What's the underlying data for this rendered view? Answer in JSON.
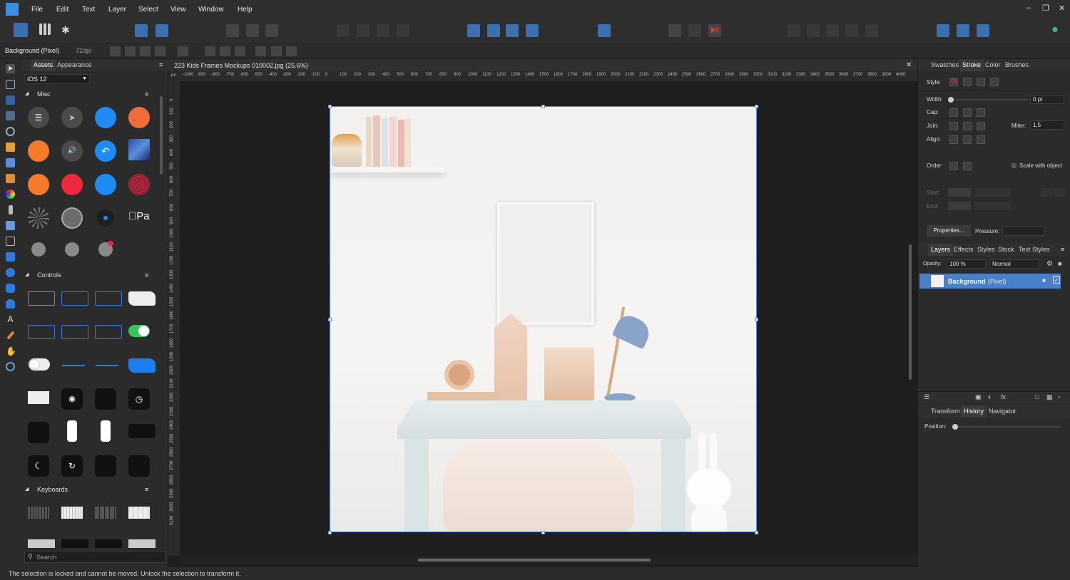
{
  "menu": {
    "file": "File",
    "edit": "Edit",
    "text": "Text",
    "layer": "Layer",
    "select": "Select",
    "view": "View",
    "window": "Window",
    "help": "Help"
  },
  "context": {
    "layer_label": "Background (Pixel)",
    "dpi": "72dpi"
  },
  "assets": {
    "tabs": [
      "Assets",
      "Appearance"
    ],
    "category": "iOS 12",
    "sections": [
      "Misc",
      "Controls",
      "Keyboards"
    ],
    "search_placeholder": "Search"
  },
  "document": {
    "title": "223 Kids Frames Mockups 010002.jpg (25.6%)",
    "ruler_unit": "px",
    "h_ticks": [
      "-1000",
      "-900",
      "-800",
      "-700",
      "-600",
      "-500",
      "-400",
      "-300",
      "-200",
      "-100",
      "0",
      "100",
      "200",
      "300",
      "400",
      "500",
      "600",
      "700",
      "800",
      "900",
      "1000",
      "1100",
      "1200",
      "1300",
      "1400",
      "1500",
      "1600",
      "1700",
      "1800",
      "1900",
      "2000",
      "2100",
      "2200",
      "2300",
      "2400",
      "2500",
      "2600",
      "2700",
      "2800",
      "2900",
      "3000",
      "3100",
      "3200",
      "3300",
      "3400",
      "3500",
      "3600",
      "3700",
      "3800",
      "3900",
      "4000"
    ],
    "v_ticks": [
      "0",
      "100",
      "200",
      "300",
      "400",
      "500",
      "600",
      "700",
      "800",
      "900",
      "1000",
      "1100",
      "1200",
      "1300",
      "1400",
      "1500",
      "1600",
      "1700",
      "1800",
      "1900",
      "2000",
      "2100",
      "2200",
      "2300",
      "2400",
      "2500",
      "2600",
      "2700",
      "2800",
      "2900",
      "3000",
      "3100"
    ]
  },
  "stroke": {
    "tabs": [
      "Swatches",
      "Stroke",
      "Color",
      "Brushes"
    ],
    "style_label": "Style:",
    "width_label": "Width:",
    "width_value": "0 pt",
    "cap_label": "Cap:",
    "join_label": "Join:",
    "miter_label": "Miter:",
    "miter_value": "1,5",
    "align_label": "Align:",
    "order_label": "Order:",
    "scale_label": "Scale with object",
    "start_label": "Start:",
    "end_label": "End:",
    "properties_label": "Properties...",
    "pressure_label": "Pressure:"
  },
  "layers": {
    "tabs": [
      "Layers",
      "Effects",
      "Styles",
      "Stock",
      "Text Styles"
    ],
    "opacity_label": "Opacity:",
    "opacity_value": "100 %",
    "blend_mode": "Normal",
    "layer_name": "Background",
    "layer_type": "(Pixel)"
  },
  "history": {
    "tabs": [
      "Transform",
      "History",
      "Navigator"
    ],
    "position_label": "Position:"
  },
  "status": {
    "message": "The selection is locked and cannot be moved. Unlock the selection to transform it."
  },
  "colors": {
    "accent": "#3b82d6",
    "selection_layer": "#4a7fc9",
    "panel": "#2b2b2b",
    "canvas_bg": "#1e1e1e"
  }
}
